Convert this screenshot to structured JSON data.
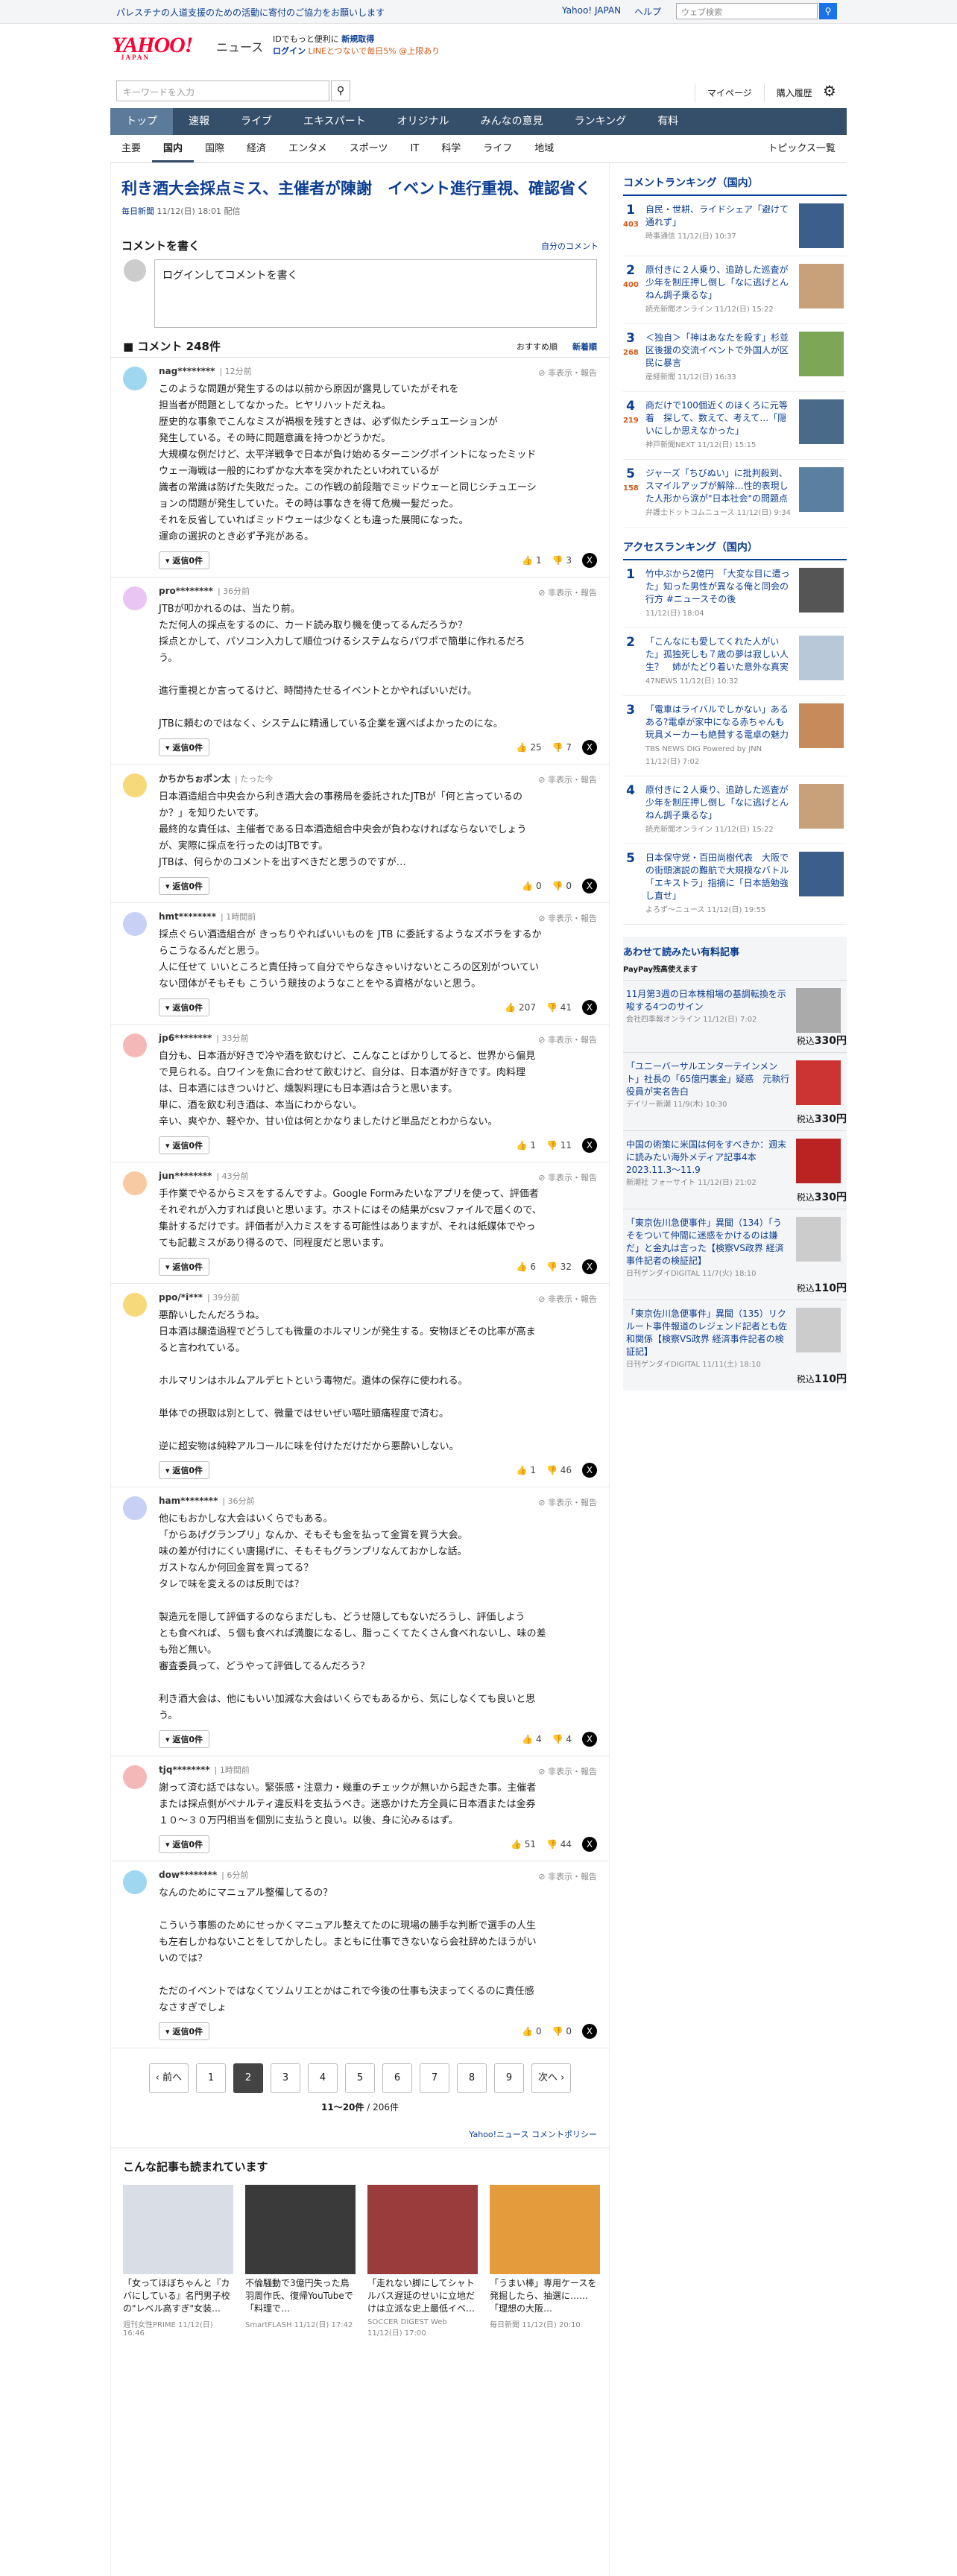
{
  "topbar": {
    "promo": "パレスチナの人道支援のための活動に寄付のご協力をお願いします",
    "links": [
      "Yahoo! JAPAN",
      "ヘルプ"
    ],
    "search_placeholder": "ウェブ検索",
    "search_icon": "search-icon"
  },
  "header": {
    "logo": "YAHOO!",
    "logo_sub": "JAPAN",
    "news": "ニュース",
    "login_line1a": "IDでもっと便利に",
    "login_line1b": "新規取得",
    "login_line2a": "ログイン",
    "login_line2b": "LINEとつないで毎日5% @上限あり"
  },
  "search": {
    "placeholder": "キーワードを入力",
    "links": [
      "マイページ",
      "購入履歴"
    ]
  },
  "mainnav": [
    "トップ",
    "速報",
    "ライブ",
    "エキスパート",
    "オリジナル",
    "みんなの意見",
    "ランキング",
    "有料"
  ],
  "subnav": [
    "主要",
    "国内",
    "国際",
    "経済",
    "エンタメ",
    "スポーツ",
    "IT",
    "科学",
    "ライフ",
    "地域"
  ],
  "subnav_right": "トピックス一覧",
  "article": {
    "title": "利き酒大会採点ミス、主催者が陳謝　イベント進行重視、確認省く",
    "source": "毎日新聞",
    "date": "11/12(日) 18:01 配信"
  },
  "write": {
    "heading": "コメントを書く",
    "policy_link": "自分のコメント",
    "placeholder": "ログインしてコメントを書く"
  },
  "comments_header": {
    "title": "コメント 248件",
    "sort_recommended": "おすすめ順",
    "sort_new": "新着順"
  },
  "comment_tools": "非表示・報告",
  "reply_label": "返信0件",
  "comments": [
    {
      "user": "nag********",
      "time": "12分前",
      "color": "#9fd6f0",
      "body": "このような問題が発生するのは以前から原因が露見していたがそれを\n担当者が問題としてなかった。ヒヤリハットだえね。\n歴史的な事象でこんなミスが禍根を残すときは、必ず似たシチュエーションが\n発生している。その時に問題意識を持つかどうかだ。\n大規模な例だけど、太平洋戦争で日本が負け始めるターニングポイントになったミッド\nウェー海戦は一般的にわずかな大本を突かれたといわれているが\n識者の常識は防げた失敗だった。この作戦の前段階でミッドウェーと同じシチュエーシ\nョンの問題が発生していた。その時は事なきを得て危機一髪だった。\nそれを反省していればミッドウェーは少なくとも違った展開になった。\n運命の選択のとき必ず予兆がある。",
      "up": "1",
      "down": "3"
    },
    {
      "user": "pro********",
      "time": "36分前",
      "color": "#e8c5f2",
      "body": "JTBが叩かれるのは、当たり前。\nただ何人の採点をするのに、カード読み取り機を使ってるんだろうか？\n採点とかして、パソコン入力して順位つけるシステムならパワポで簡単に作れるだろ\nう。\n\n進行重視とか言ってるけど、時間持たせるイベントとかやればいいだけ。\n\nJTBに頼むのではなく、システムに精通している企業を選べばよかったのにな。",
      "up": "25",
      "down": "7"
    },
    {
      "user": "かちかちぉポン太",
      "time": "たった今",
      "color": "#f5d97a",
      "body": "日本酒造組合中央会から利き酒大会の事務局を委託されたJTBが「何と言っているの\nか？」を知りたいです。\n最終的な責任は、主催者である日本酒造組合中央会が負わなければならないでしょう\nが、実際に採点を行ったのはJTBです。\nJTBは、何らかのコメントを出すべきだと思うのですが…",
      "up": "0",
      "down": "0"
    },
    {
      "user": "hmt********",
      "time": "1時間前",
      "color": "#c9d0f5",
      "body": "採点ぐらい酒造組合が きっちりやればいいものを JTB に委託するようなズボラをするか\nらこうなるんだと思う。\n人に任せて いいところと責任持って自分でやらなきゃいけないところの区別がついてい\nない団体がそもそも こういう競技のようなことをやる資格がないと思う。",
      "up": "207",
      "down": "41"
    },
    {
      "user": "jp6********",
      "time": "33分前",
      "color": "#f5b8b8",
      "body": "自分も、日本酒が好きで冷や酒を飲むけど、こんなことばかりしてると、世界から偏見\nで見られる。白ワインを魚に合わせて飲むけど、自分は、日本酒が好きです。肉料理\nは、日本酒にはきついけど、燻製料理にも日本酒は合うと思います。\n単に、酒を飲む利き酒は、本当にわからない。\n辛い、爽やか、軽やか、甘い位は何とかなりましたけど単品だとわからない。",
      "up": "1",
      "down": "11"
    },
    {
      "user": "jun********",
      "time": "43分前",
      "color": "#f7caa3",
      "body": "手作業でやるからミスをするんですよ。Google Formみたいなアプリを使って、評価者\nそれぞれが入力すれば良いと思います。ホストにはその結果がcsvファイルで届くので、\n集計するだけです。評価者が入力ミスをする可能性はありますが、それは紙媒体でやっ\nても記載ミスがあり得るので、同程度だと思います。",
      "up": "6",
      "down": "32"
    },
    {
      "user": "ppo/*i***",
      "time": "39分前",
      "color": "#f5d97a",
      "body": "悪酔いしたんだろうね。\n日本酒は醸造過程でどうしても微量のホルマリンが発生する。安物ほどその比率が高ま\nると言われている。\n\nホルマリンはホルムアルデヒトという毒物だ。遺体の保存に使われる。\n\n単体での摂取は別として、微量ではせいぜい嘔吐頭痛程度で済む。\n\n逆に超安物は純粋アルコールに味を付けただけだから悪酔いしない。",
      "up": "1",
      "down": "46"
    },
    {
      "user": "ham********",
      "time": "36分前",
      "color": "#c9d0f5",
      "body": "他にもおかしな大会はいくらでもある。\n「からあげグランプリ」なんか、そもそも金を払って金賞を買う大会。\n味の差が付けにくい唐揚げに、そもそもグランプリなんておかしな話。\nガストなんか何回金賞を買ってる？\nタレで味を変えるのは反則では？\n\n製造元を隠して評価するのならまだしも、どうせ隠してもないだろうし、評価しよう\nとも食べれば、５個も食べれば満腹になるし、脂っこくてたくさん食べれないし、味の差\nも殆ど無い。\n審査委員って、どうやって評価してるんだろう？\n\n利き酒大会は、他にもいい加減な大会はいくらでもあるから、気にしなくても良いと思\nう。",
      "up": "4",
      "down": "4"
    },
    {
      "user": "tjq********",
      "time": "1時間前",
      "color": "#f5b8b8",
      "body": "謝って済む話ではない。緊張感・注意力・幾重のチェックが無いから起きた事。主催者\nまたは採点側がペナルティ違反料を支払うべき。迷惑かけた方全員に日本酒または金券\n１０〜３０万円相当を個別に支払うと良い。以後、身に沁みるはず。",
      "up": "51",
      "down": "44"
    },
    {
      "user": "dow********",
      "time": "6分前",
      "color": "#9fd6f0",
      "body": "なんのためにマニュアル整備してるの？\n\nこういう事態のためにせっかくマニュアル整えてたのに現場の勝手な判断で選手の人生\nも左右しかねないことをしてかしたし。まともに仕事できないなら会社辞めたほうがい\nいのでは？\n\nただのイベントではなくてソムリエとかはこれで今後の仕事も決まってくるのに責任感\nなさすぎでしょ",
      "up": "0",
      "down": "0"
    }
  ],
  "pager": {
    "prev": "前へ",
    "pages": [
      "1",
      "2",
      "3",
      "4",
      "5",
      "6",
      "7",
      "8",
      "9"
    ],
    "current": "2",
    "next": "次へ",
    "count": "11〜20件",
    "total": "/ 206件"
  },
  "policy": "Yahoo!ニュース コメントポリシー",
  "alsoread": {
    "title": "こんな記事も読まれています",
    "cards": [
      {
        "t": "「女ってほぼちゃんと『カバにしている』名門男子校の\"レベル高すぎ\"女装…",
        "s": "週刊女性PRIME 11/12(日) 16:46",
        "c": "#d8dde6"
      },
      {
        "t": "不倫騒動で3億円失った鳥羽周作氏、復帰YouTubeで「料理で…",
        "s": "SmartFLASH 11/12(日) 17:42",
        "c": "#3a3a3a"
      },
      {
        "t": "「走れない脚にしてシャトルバス遅延のせいに立地だけは立派な史上最低イベ…",
        "s": "SOCCER DIGEST Web 11/12(日) 17:00",
        "c": "#9a3c3c"
      },
      {
        "t": "「うまい棒」専用ケースを発掘したら、抽選に……「理想の大阪…",
        "s": "毎日新聞 11/12(日) 20:10",
        "c": "#e39b3b"
      }
    ]
  },
  "side_ranking": {
    "title": "コメントランキング（国内）",
    "items": [
      {
        "n": "1",
        "cnt": "403",
        "t": "自民・世耕、ライドシェア「避けて通れず」",
        "m": "時事通信 11/12(日) 10:37",
        "c": "#3b5f8a"
      },
      {
        "n": "2",
        "cnt": "400",
        "t": "原付きに２人乗り、追跡した巡査が少年を制圧押し倒し「なに逃げとんねん調子乗るな」",
        "m": "読売新聞オンライン 11/12(日) 15:22",
        "c": "#c8a07a"
      },
      {
        "n": "3",
        "cnt": "268",
        "t": "＜独自＞「神はあなたを殺す」杉並区後援の交流イベントで外国人が区民に暴言",
        "m": "産経新聞 11/12(日) 16:33",
        "c": "#7ea657"
      },
      {
        "n": "4",
        "cnt": "219",
        "t": "商だけで100個近くのほくろに元等着　探して、数えて、考えて…「隠いにしか思えなかった」",
        "m": "神戸新聞NEXT 11/12(日) 15:15",
        "c": "#4a6a8a"
      },
      {
        "n": "5",
        "cnt": "158",
        "t": "ジャーズ「ちびぬい」に批判殺到、スマイルアップが解除…性的表現した人形から涙が\"日本社会\"の問題点",
        "m": "弁護士ドットコムニュース 11/12(日) 9:34",
        "c": "#5a7fa0"
      }
    ]
  },
  "side_access": {
    "title": "アクセスランキング（国内）",
    "items": [
      {
        "n": "1",
        "t": "竹中ぷから2億円　「大変な目に遭った」知った男性が異なる俺と同会の行方 #ニュースその後",
        "m": "11/12(日) 18:04",
        "c": "#555"
      },
      {
        "n": "2",
        "t": "「こんなにも愛してくれた人がいた」孤独死しも７歳の夢は寂しい人生？　姉がたどり着いた意外な真実",
        "m": "47NEWS 11/12(日) 10:32",
        "c": "#b8c8d8"
      },
      {
        "n": "3",
        "t": "「電車はライバルでしかない」あるある?電卓が家中になる赤ちゃんも玩具メーカーも絶賛する電卓の魅力",
        "m": "TBS NEWS DIG Powered by JNN 11/12(日) 7:02",
        "c": "#c78a5a"
      },
      {
        "n": "4",
        "t": "原付きに２人乗り、追跡した巡査が少年を制圧押し倒し「なに逃げとんねん調子乗るな」",
        "m": "読売新聞オンライン 11/12(日) 15:22",
        "c": "#c8a07a"
      },
      {
        "n": "5",
        "t": "日本保守党・百田尚樹代表　大阪での街頭演説の難航で大規模なバトル「エキストラ」指摘に「日本語勉強し直せ」",
        "m": "よろず〜ニュース 11/12(日) 19:55",
        "c": "#3b5f8a"
      }
    ]
  },
  "paid": {
    "title": "あわせて読みたい有料記事",
    "label": "PayPay残高使えます",
    "items": [
      {
        "t": "11月第3週の日本株相場の基調転換を示唆する4つのサイン",
        "m": "会社四季報オンライン 11/12(日) 7:02",
        "p": "330円",
        "c": "#aaa"
      },
      {
        "t": "「ユニーバーサルエンターテインメント」社長の「65億円裏金」疑惑　元執行役員が実名告白",
        "m": "デイリー新潮 11/9(木) 10:30",
        "p": "330円",
        "c": "#c33"
      },
      {
        "t": "中国の術策に米国は何をすべきか：週末に読みたい海外メディア記事4本　2023.11.3〜11.9",
        "m": "新潮社 フォーサイト 11/12(日) 21:02",
        "p": "330円",
        "c": "#b22"
      },
      {
        "t": "「東京佐川急便事件」異聞（134）「うそをついて仲間に迷惑をかけるのは嫌だ」と金丸は言った【検察VS政界 経済事件記者の検証記】",
        "m": "日刊ゲンダイDIGITAL 11/7(火) 18:10",
        "p": "110円",
        "c": "#ccc"
      },
      {
        "t": "「東京佐川急便事件」異聞（135）リクルート事件報道のレジェンド記者とも佐和関係【検察VS政界 経済事件記者の検証記】",
        "m": "日刊ゲンダイDIGITAL 11/11(土) 18:10",
        "p": "110円",
        "c": "#ccc"
      }
    ],
    "prefix": "税込"
  }
}
